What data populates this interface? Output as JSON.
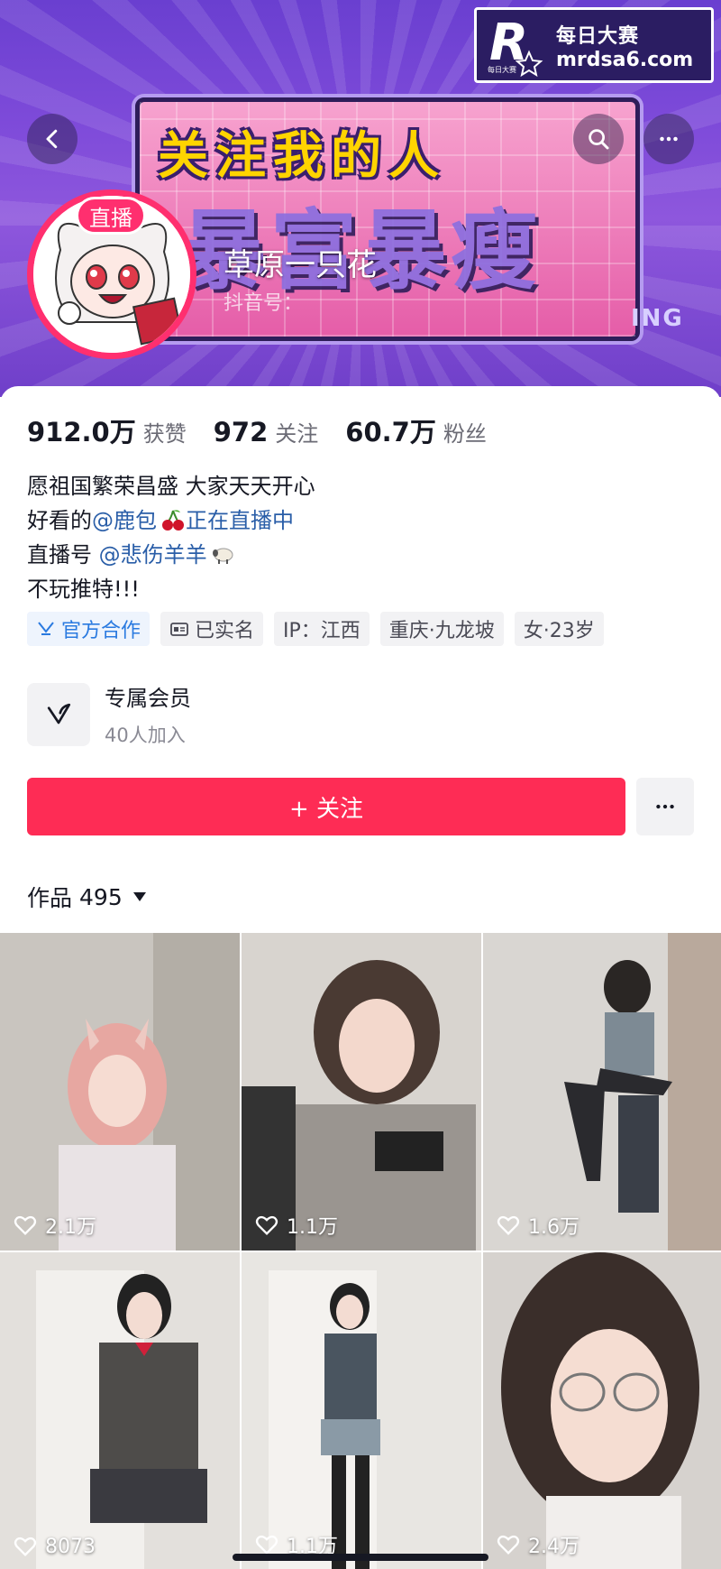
{
  "watermark": {
    "logo_letter": "R",
    "logo_small": "每日大赛",
    "title": "每日大赛",
    "site": "mrdsa6.com"
  },
  "banner": {
    "headline": "关注我的人",
    "headline2": "暴富暴瘦",
    "corner_text": "ING"
  },
  "profile": {
    "live_badge": "直播",
    "nickname": "草原一只花",
    "douyin_id": "抖音号：",
    "stats": [
      {
        "value": "912.0万",
        "label": "获赞"
      },
      {
        "value": "972",
        "label": "关注"
      },
      {
        "value": "60.7万",
        "label": "粉丝"
      }
    ],
    "bio": {
      "line1": "愿祖国繁荣昌盛 大家天天开心",
      "line2_prefix": "好看的",
      "line2_mention": "@鹿包",
      "line2_suffix": "正在直播中",
      "line3_prefix": "直播号",
      "line3_mention": "@悲伤羊羊",
      "line4": "不玩推特!!!"
    },
    "tags": [
      "官方合作",
      "已实名",
      "IP：江西",
      "重庆·九龙坡",
      "女·23岁"
    ],
    "member": {
      "title": "专属会员",
      "subtitle": "40人加入"
    },
    "follow_label": "+ 关注"
  },
  "works": {
    "label": "作品",
    "count": "495",
    "items": [
      {
        "likes": "2.1万"
      },
      {
        "likes": "1.1万"
      },
      {
        "likes": "1.6万"
      },
      {
        "likes": "8073"
      },
      {
        "likes": "1.1万"
      },
      {
        "likes": "2.4万"
      }
    ]
  },
  "colors": {
    "accent": "#fe2c55",
    "mention": "#2a5ea8",
    "live": "#ff2f6f"
  },
  "icons": [
    "back-icon",
    "search-icon",
    "more-icon",
    "official-icon",
    "id-card-icon",
    "member-v-icon",
    "heart-icon",
    "caret-down-icon"
  ]
}
